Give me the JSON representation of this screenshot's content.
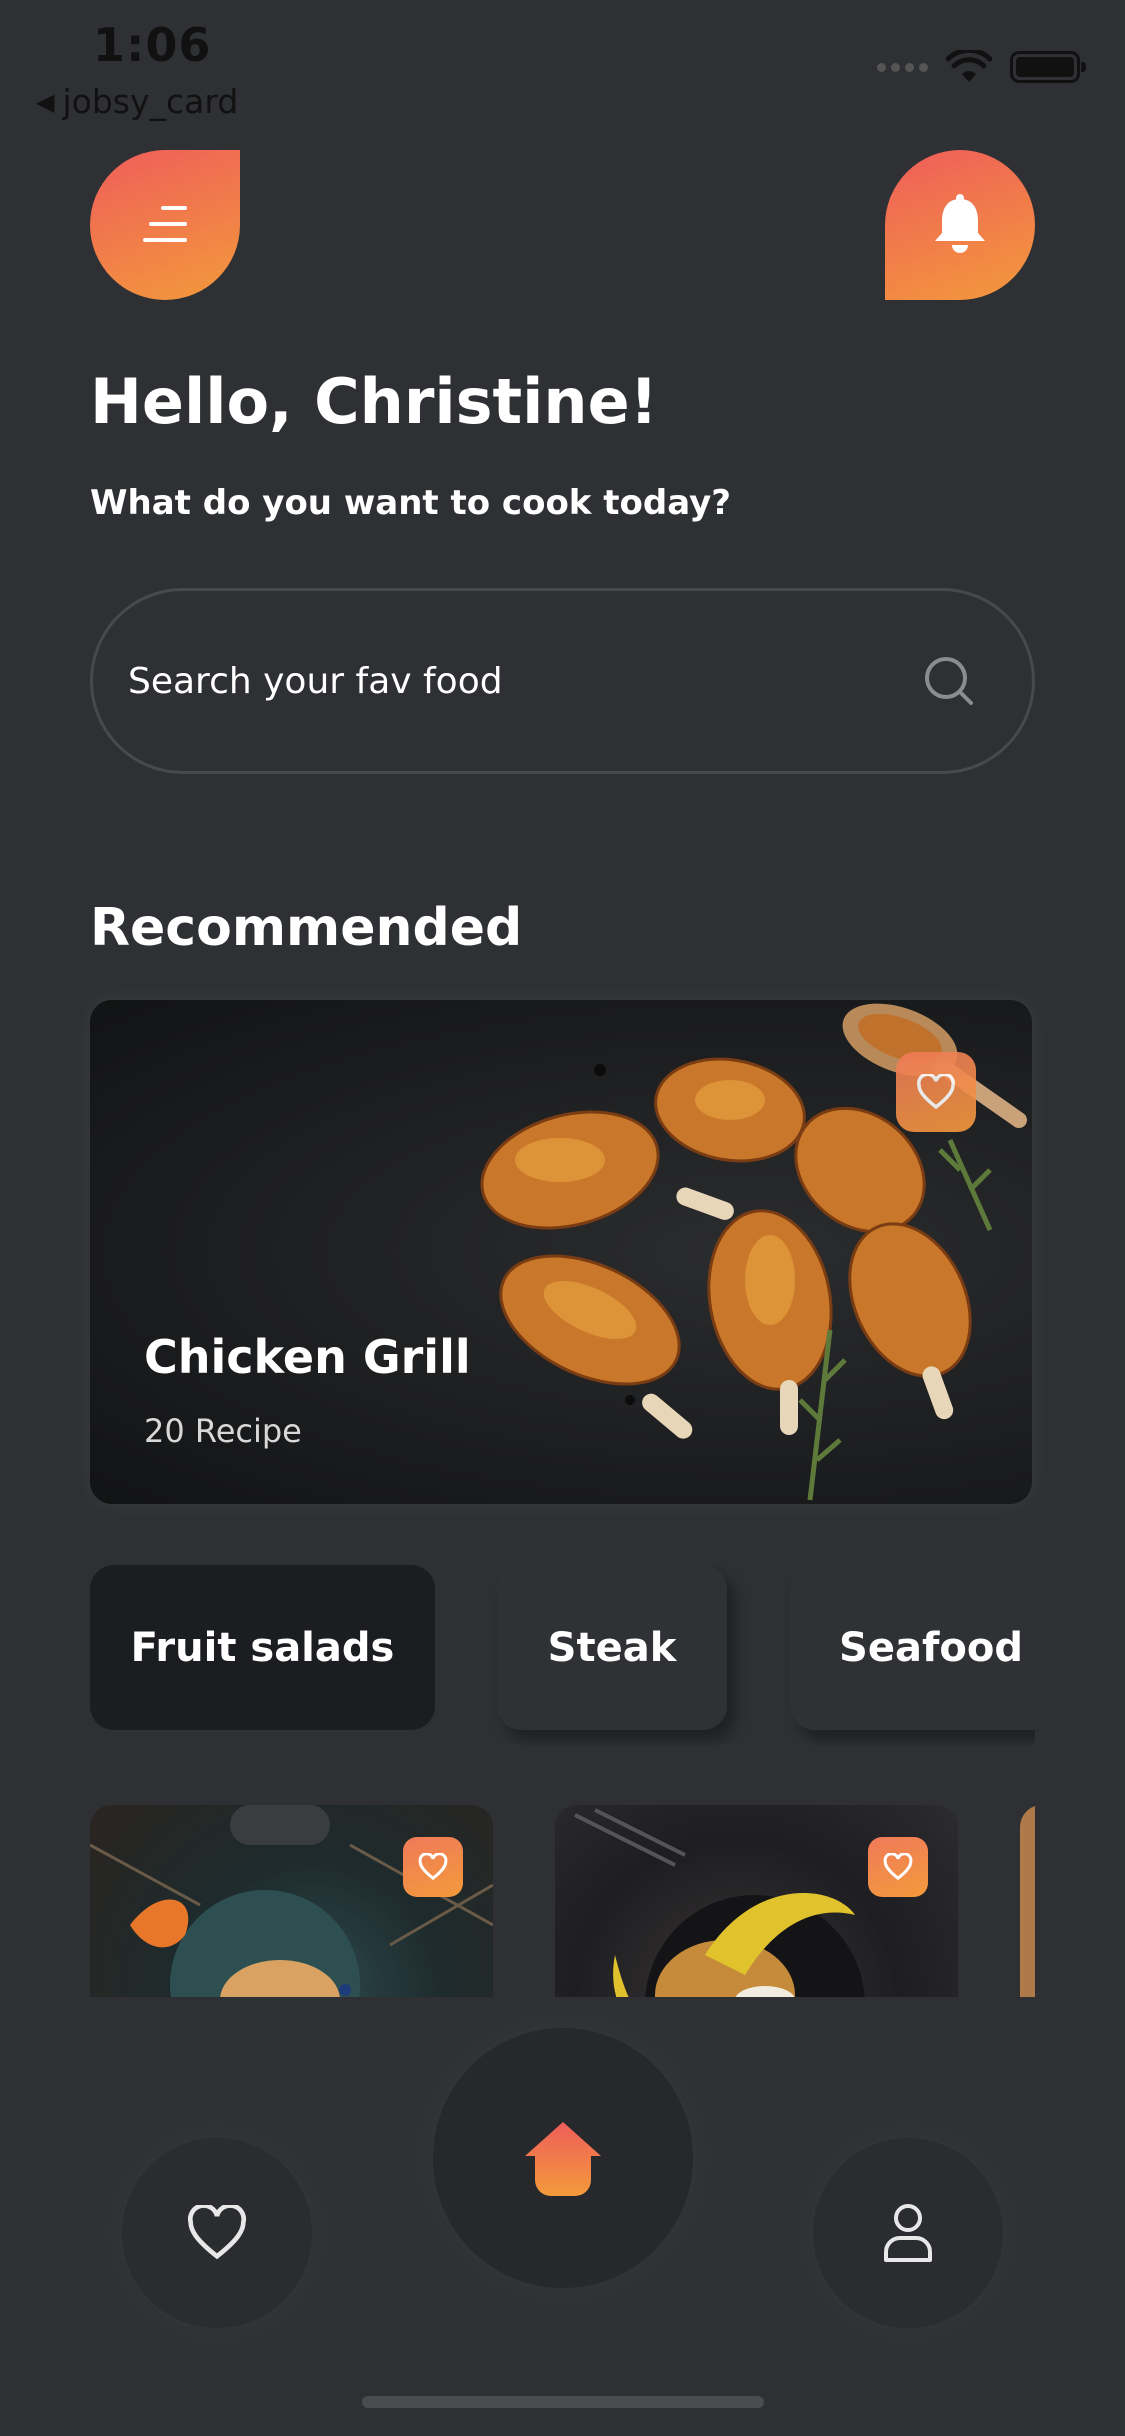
{
  "status_bar": {
    "time": "1:06",
    "back_app": "jobsy_card"
  },
  "header": {
    "menu_icon": "menu-icon",
    "notification_icon": "bell-icon"
  },
  "greeting": "Hello, Christine!",
  "subtitle": "What do you want to cook today?",
  "search": {
    "placeholder": "Search your fav food"
  },
  "recommended": {
    "title": "Recommended",
    "featured": {
      "title": "Chicken Grill",
      "subtitle": "20 Recipe"
    }
  },
  "categories": [
    {
      "label": "Fruit salads",
      "active": true
    },
    {
      "label": "Steak",
      "active": false
    },
    {
      "label": "Seafood",
      "active": false
    }
  ],
  "bottom_nav": {
    "left_icon": "heart-icon",
    "center_icon": "home-icon",
    "right_icon": "profile-icon"
  },
  "colors": {
    "accent_start": "#ef5d5a",
    "accent_end": "#f39a3b",
    "background": "#2e3033"
  }
}
